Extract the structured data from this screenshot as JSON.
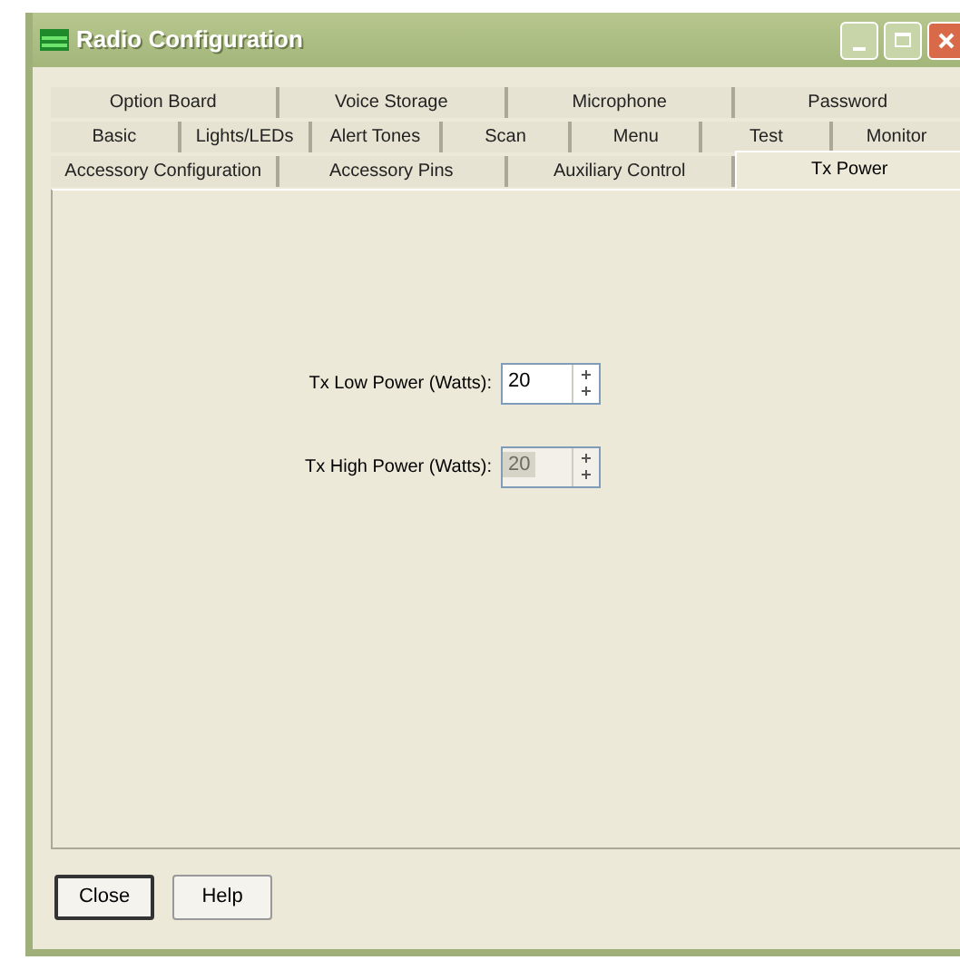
{
  "window": {
    "title": "Radio Configuration"
  },
  "tab_rows": [
    [
      {
        "label": "Option Board",
        "selected": false
      },
      {
        "label": "Voice Storage",
        "selected": false
      },
      {
        "label": "Microphone",
        "selected": false
      },
      {
        "label": "Password",
        "selected": false
      }
    ],
    [
      {
        "label": "Basic",
        "selected": false
      },
      {
        "label": "Lights/LEDs",
        "selected": false
      },
      {
        "label": "Alert Tones",
        "selected": false
      },
      {
        "label": "Scan",
        "selected": false
      },
      {
        "label": "Menu",
        "selected": false
      },
      {
        "label": "Test",
        "selected": false
      },
      {
        "label": "Monitor",
        "selected": false
      }
    ],
    [
      {
        "label": "Accessory Configuration",
        "selected": false
      },
      {
        "label": "Accessory Pins",
        "selected": false
      },
      {
        "label": "Auxiliary Control",
        "selected": false
      },
      {
        "label": "Tx Power",
        "selected": true
      }
    ]
  ],
  "fields": [
    {
      "label": "Tx Low Power (Watts):",
      "value": "20",
      "disabled": false
    },
    {
      "label": "Tx High Power (Watts):",
      "value": "20",
      "disabled": true
    }
  ],
  "buttons": [
    {
      "label": "Close",
      "default": true
    },
    {
      "label": "Help",
      "default": false
    }
  ]
}
